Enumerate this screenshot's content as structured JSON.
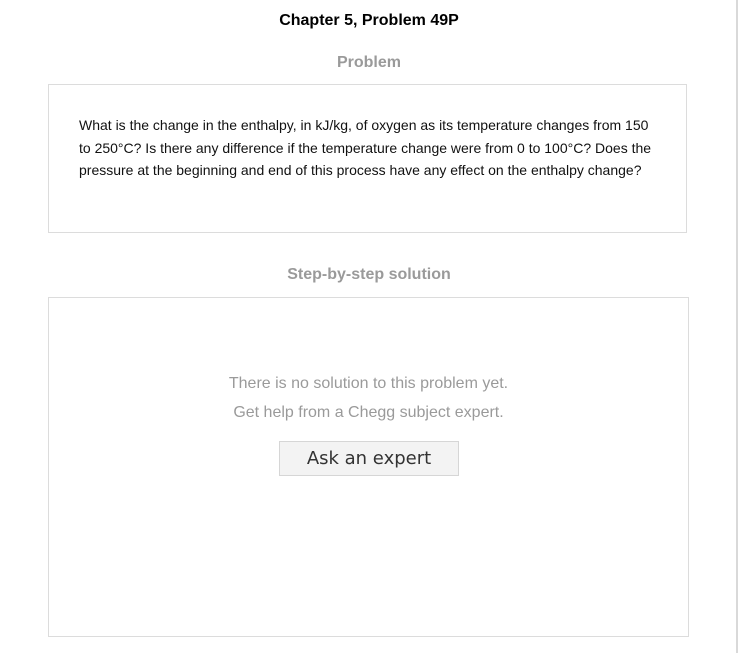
{
  "header": {
    "chapter_title": "Chapter 5, Problem 49P"
  },
  "problem": {
    "heading": "Problem",
    "text": "What is the change in the enthalpy, in kJ/kg, of oxygen as its temperature changes from 150 to 250°C? Is there any difference if the temperature change were from 0 to 100°C? Does the pressure at the beginning and end of this process have any effect on the enthalpy change?"
  },
  "solution": {
    "heading": "Step-by-step solution",
    "empty_line_1": "There is no solution to this problem yet.",
    "empty_line_2": "Get help from a Chegg subject expert.",
    "ask_button_label": "Ask an expert"
  }
}
